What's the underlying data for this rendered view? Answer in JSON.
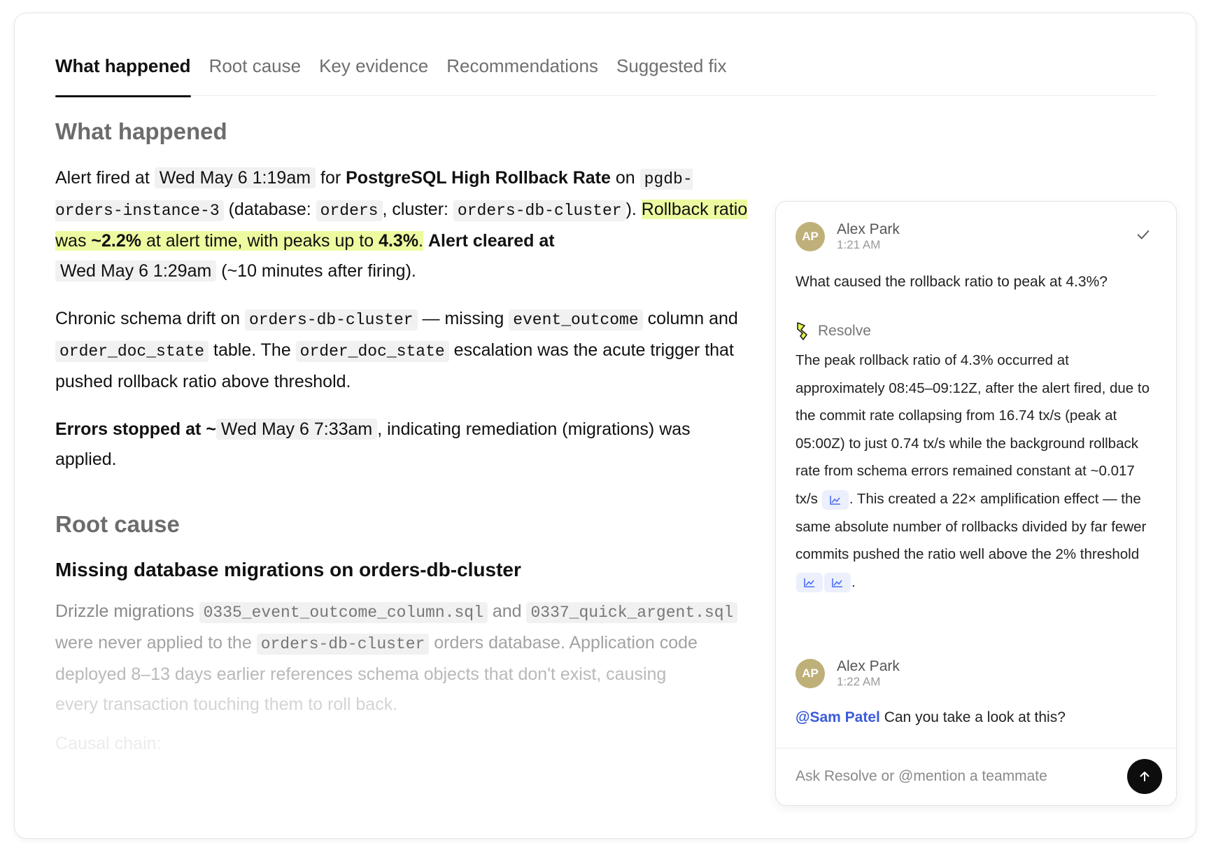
{
  "tabs": [
    {
      "label": "What happened",
      "active": true
    },
    {
      "label": "Root cause",
      "active": false
    },
    {
      "label": "Key evidence",
      "active": false
    },
    {
      "label": "Recommendations",
      "active": false
    },
    {
      "label": "Suggested fix",
      "active": false
    }
  ],
  "what_happened": {
    "title": "What happened",
    "p1": {
      "t1": "Alert fired at ",
      "fired_at": "Wed May 6 1:19am",
      "t2": " for ",
      "alert_name": "PostgreSQL High Rollback Rate",
      "t3": " on ",
      "instance": "pgdb-orders-instance-3",
      "t4": " (database: ",
      "database": "orders",
      "t5": ", cluster: ",
      "cluster": "orders-db-cluster",
      "t6": "). ",
      "hl1": "Rollback ratio was ",
      "hl_val1": "~2.2%",
      "hl2": " at alert time, with peaks up to ",
      "hl_val2": "4.3%",
      "hl3": ".",
      "t7": " ",
      "cleared_label": "Alert cleared at",
      "cleared_at": "Wed May 6 1:29am",
      "t8": " (~10 minutes after firing)."
    },
    "p2": {
      "t1": "Chronic schema drift on ",
      "cluster": "orders-db-cluster",
      "t2": " — missing ",
      "column": "event_outcome",
      "t3": " column and ",
      "table": "order_doc_state",
      "t4": " table. The ",
      "table2": "order_doc_state",
      "t5": " escalation was the acute trigger that pushed rollback ratio above threshold."
    },
    "p3": {
      "stopped_label": "Errors stopped at ~",
      "stopped_at": "Wed May 6 7:33am",
      "t1": ", indicating remediation (migrations) was applied."
    }
  },
  "root_cause": {
    "title": "Root cause",
    "subtitle": "Missing database migrations on orders-db-cluster",
    "t1": "Drizzle migrations ",
    "file1": "0335_event_outcome_column.sql",
    "t2": " and ",
    "file2": "0337_quick_argent.sql",
    "t3": " were never applied to the ",
    "cluster": "orders-db-cluster",
    "t4": " orders database. Application code ",
    "t5": "deployed 8–13 days earlier references schema objects that don't exist, causing ",
    "t6": "every transaction touching them to roll back.",
    "causal_chain": "Causal chain:"
  },
  "chat": {
    "messages": [
      {
        "initials": "AP",
        "author": "Alex Park",
        "time": "1:21 AM",
        "text": "What caused the rollback ratio to peak at 4.3%?"
      },
      {
        "initials": "AP",
        "author": "Alex Park",
        "time": "1:22 AM",
        "mention": "@Sam Patel",
        "text": " Can you take a look at this?"
      }
    ],
    "resolve": {
      "name": "Resolve",
      "a1": "The peak rollback ratio of 4.3% occurred at approximately 08:45–09:12Z, after the alert fired, due to the commit rate collapsing from 16.74 tx/s (peak at 05:00Z) to just 0.74 tx/s while the background rollback rate from schema errors remained constant at ~0.017 tx/s",
      "a2": ". This created a 22× amplification effect — the same absolute number of rollbacks divided by far fewer commits pushed the ratio well above the 2% threshold",
      "a3": "."
    },
    "composer_placeholder": "Ask Resolve or @mention a teammate",
    "icons": {
      "resolved": "check-icon",
      "send": "arrow-up-icon",
      "chart": "line-chart-icon",
      "resolve_logo": "resolve-logo-icon"
    },
    "colors": {
      "avatar": "#bfb07a",
      "mention": "#3b5bdb",
      "highlight": "#eefaa0",
      "chart_chip": "#eceffc"
    }
  }
}
